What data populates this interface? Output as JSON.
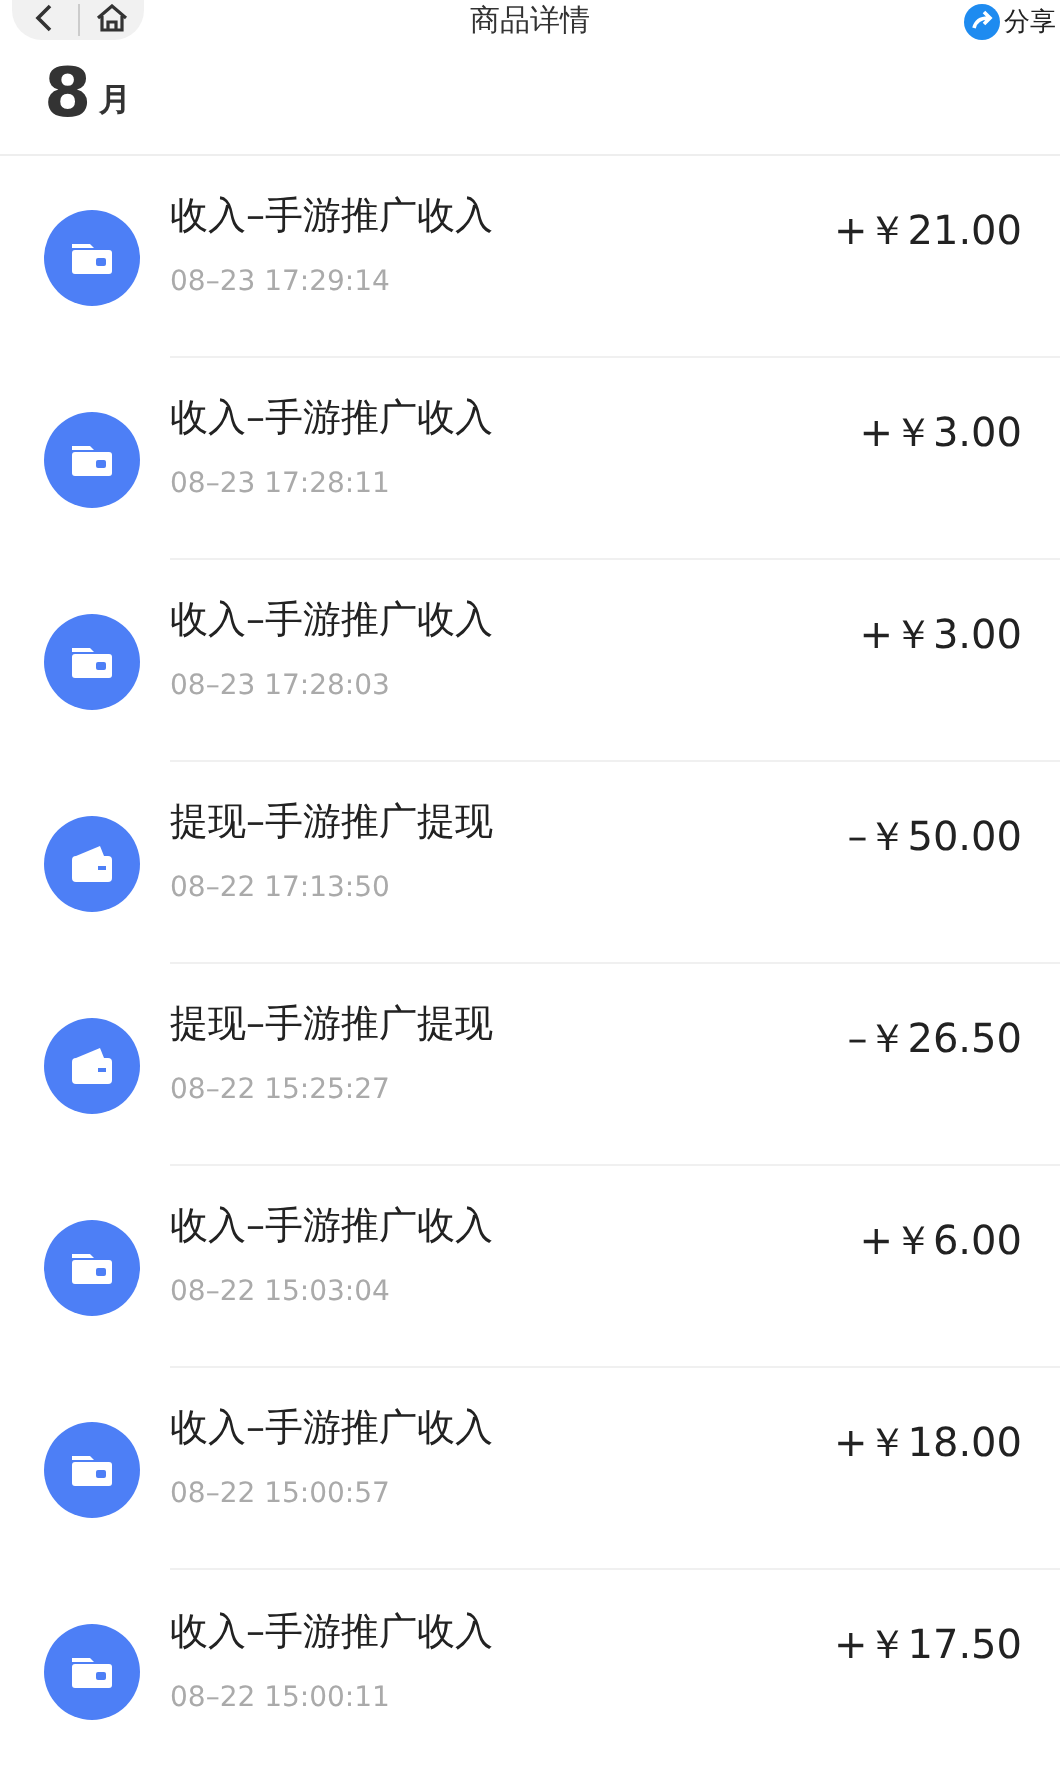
{
  "nav_bar": {
    "title": "商品详情",
    "share": "分享"
  },
  "month": {
    "number": "8",
    "unit": "月"
  },
  "transactions": [
    {
      "kind": "income",
      "title": "收入–手游推广收入",
      "time": "08–23 17:29:14",
      "amount": "+￥21.00"
    },
    {
      "kind": "income",
      "title": "收入–手游推广收入",
      "time": "08–23 17:28:11",
      "amount": "+￥3.00"
    },
    {
      "kind": "income",
      "title": "收入–手游推广收入",
      "time": "08–23 17:28:03",
      "amount": "+￥3.00"
    },
    {
      "kind": "withdrawal",
      "title": "提现–手游推广提现",
      "time": "08–22 17:13:50",
      "amount": "–￥50.00"
    },
    {
      "kind": "withdrawal",
      "title": "提现–手游推广提现",
      "time": "08–22 15:25:27",
      "amount": "–￥26.50"
    },
    {
      "kind": "income",
      "title": "收入–手游推广收入",
      "time": "08–22 15:03:04",
      "amount": "+￥6.00"
    },
    {
      "kind": "income",
      "title": "收入–手游推广收入",
      "time": "08–22 15:00:57",
      "amount": "+￥18.00"
    },
    {
      "kind": "income",
      "title": "收入–手游推广收入",
      "time": "08–22 15:00:11",
      "amount": "+￥17.50"
    }
  ]
}
